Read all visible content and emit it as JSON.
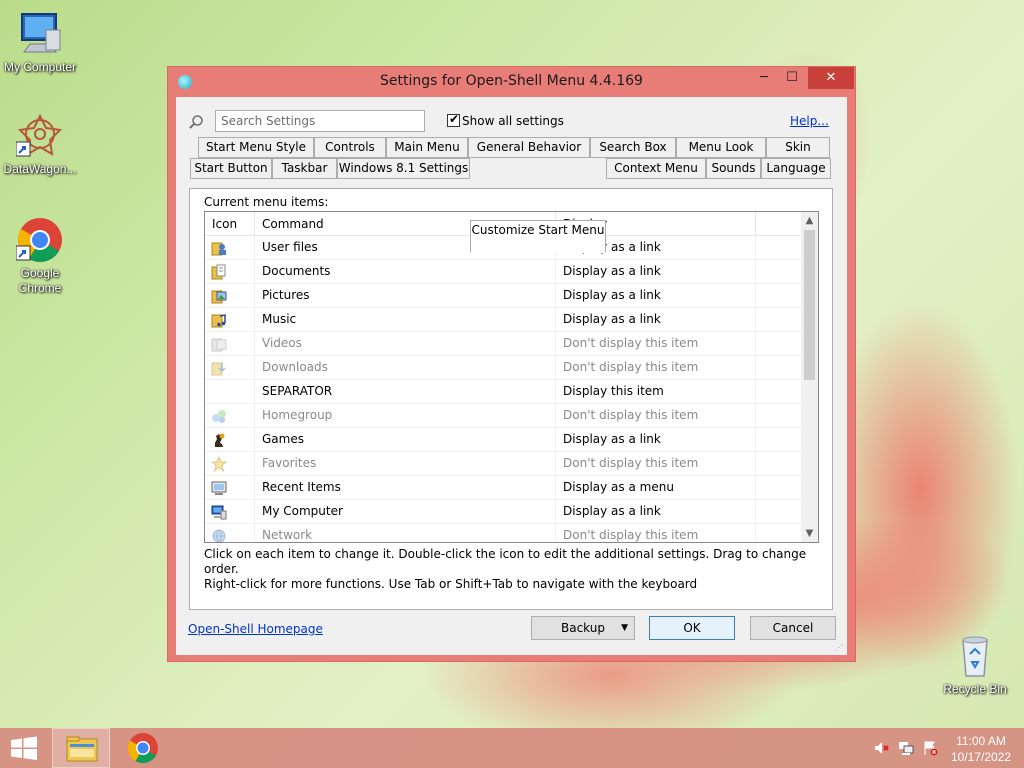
{
  "desktop": {
    "icons": [
      {
        "label": "My Computer",
        "icon": "computer-icon"
      },
      {
        "label": "DataWagon...",
        "icon": "datawagon-icon"
      },
      {
        "label": "Google Chrome",
        "icon": "chrome-icon"
      },
      {
        "label": "Recycle Bin",
        "icon": "recycle-bin-icon"
      }
    ]
  },
  "window": {
    "title": "Settings for Open-Shell Menu 4.4.169",
    "controls": {
      "minimize": "─",
      "maximize": "☐",
      "close": "✕"
    }
  },
  "toolbar": {
    "search_placeholder": "Search Settings",
    "show_all_checked": true,
    "show_all_label": "Show all settings",
    "help_label": "Help..."
  },
  "tabs": {
    "row1": [
      "Start Menu Style",
      "Controls",
      "Main Menu",
      "General Behavior",
      "Search Box",
      "Menu Look",
      "Skin"
    ],
    "row2": [
      "Start Button",
      "Taskbar",
      "Windows 8.1 Settings",
      "Customize Start Menu",
      "Context Menu",
      "Sounds",
      "Language"
    ],
    "active": "Customize Start Menu"
  },
  "menu_items": {
    "caption": "Current menu items:",
    "columns": [
      "Icon",
      "Command",
      "Display"
    ],
    "rows": [
      {
        "icon": "user-files-icon",
        "command": "User files",
        "display": "Display as a link",
        "enabled": true
      },
      {
        "icon": "documents-icon",
        "command": "Documents",
        "display": "Display as a link",
        "enabled": true
      },
      {
        "icon": "pictures-icon",
        "command": "Pictures",
        "display": "Display as a link",
        "enabled": true
      },
      {
        "icon": "music-icon",
        "command": "Music",
        "display": "Display as a link",
        "enabled": true
      },
      {
        "icon": "videos-icon",
        "command": "Videos",
        "display": "Don't display this item",
        "enabled": false
      },
      {
        "icon": "downloads-icon",
        "command": "Downloads",
        "display": "Don't display this item",
        "enabled": false
      },
      {
        "icon": "",
        "command": "SEPARATOR",
        "display": "Display this item",
        "enabled": true
      },
      {
        "icon": "homegroup-icon",
        "command": "Homegroup",
        "display": "Don't display this item",
        "enabled": false
      },
      {
        "icon": "games-icon",
        "command": "Games",
        "display": "Display as a link",
        "enabled": true
      },
      {
        "icon": "favorites-icon",
        "command": "Favorites",
        "display": "Don't display this item",
        "enabled": false
      },
      {
        "icon": "recent-items-icon",
        "command": "Recent Items",
        "display": "Display as a menu",
        "enabled": true
      },
      {
        "icon": "my-computer-icon",
        "command": "My Computer",
        "display": "Display as a link",
        "enabled": true
      },
      {
        "icon": "network-icon",
        "command": "Network",
        "display": "Don't display this item",
        "enabled": false
      }
    ],
    "hint_line1": "Click on each item to change it. Double-click the icon to edit the additional settings. Drag to change order.",
    "hint_line2": "Right-click for more functions. Use Tab or Shift+Tab to navigate with the keyboard"
  },
  "footer": {
    "homepage_link": "Open-Shell Homepage",
    "backup_label": "Backup",
    "ok_label": "OK",
    "cancel_label": "Cancel"
  },
  "taskbar": {
    "items": [
      "start-button",
      "file-explorer",
      "chrome"
    ],
    "active_item": "file-explorer",
    "tray_icons": [
      "speaker-muted-icon",
      "network-icon",
      "action-center-flag-icon"
    ],
    "time": "11:00 AM",
    "date": "10/17/2022"
  },
  "colors": {
    "window_frame": "#e87d78",
    "close_button": "#c7403a",
    "link": "#0033cc",
    "taskbar": "#d68c80"
  }
}
